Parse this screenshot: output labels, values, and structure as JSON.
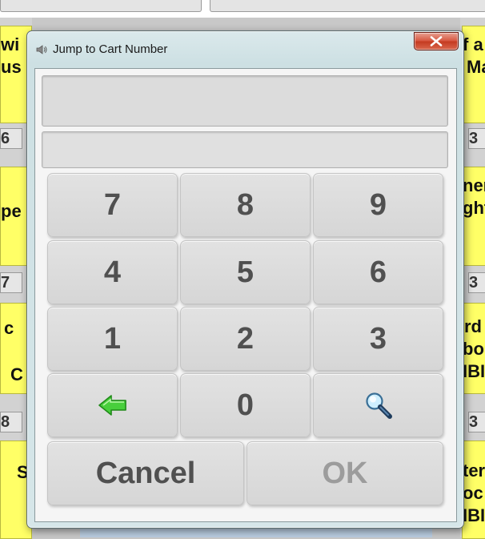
{
  "window": {
    "title": "Jump to Cart Number",
    "close_icon": "close-icon"
  },
  "display": {
    "cart_number": "",
    "cart_info": ""
  },
  "keypad": {
    "row1": [
      "7",
      "8",
      "9"
    ],
    "row2": [
      "4",
      "5",
      "6"
    ],
    "row3": [
      "1",
      "2",
      "3"
    ],
    "row4": {
      "backspace_icon": "green-left-arrow-icon",
      "zero": "0",
      "search_icon": "magnifier-icon"
    },
    "cancel_label": "Cancel",
    "ok_label": "OK"
  },
  "background": {
    "left_fragments": [
      "wi",
      "us",
      "6",
      "pe",
      "7",
      "c",
      "C",
      "8",
      "S"
    ],
    "right_fragments": [
      "f a",
      "Ma",
      "3",
      "ner",
      "ght",
      "3",
      "rd",
      "bo",
      "IBI",
      "3",
      "ter",
      "oc",
      "IBI"
    ]
  },
  "colors": {
    "cart_yellow": "#ffff66",
    "close_red": "#c43a20",
    "key_gray": "#dcdcdc",
    "backspace_green": "#3cc83c"
  }
}
